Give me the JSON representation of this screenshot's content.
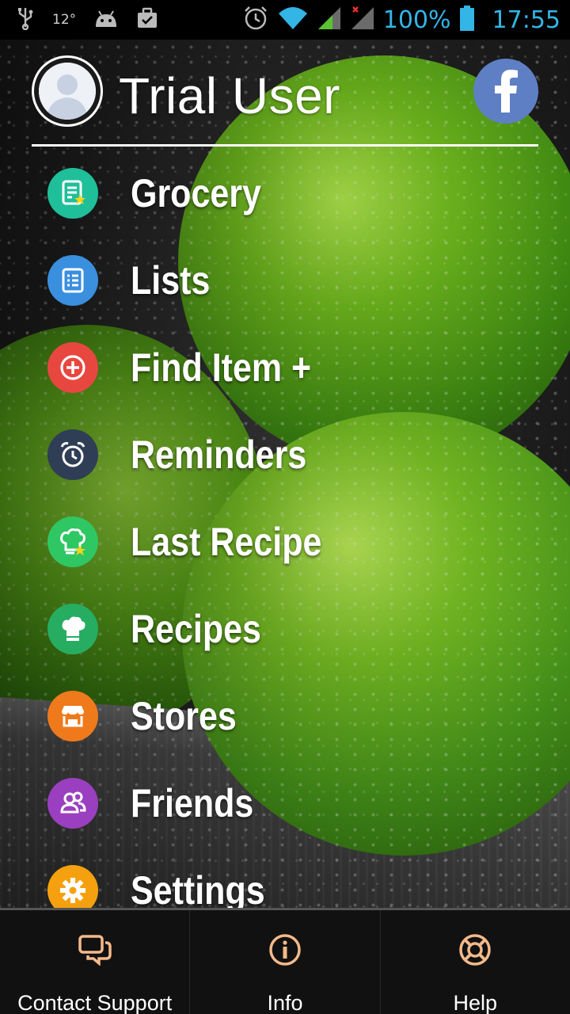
{
  "status_bar": {
    "temperature": "12°",
    "battery_percent": "100%",
    "clock": "17:55"
  },
  "drawer": {
    "user_name": "Trial User",
    "facebook_icon": "facebook-icon",
    "menu": [
      {
        "label": "Grocery",
        "icon": "grocery-list-star-icon",
        "color": "#1fbf9a"
      },
      {
        "label": "Lists",
        "icon": "list-icon",
        "color": "#3a8fde"
      },
      {
        "label": "Find Item +",
        "icon": "add-circle-icon",
        "color": "#e8473f"
      },
      {
        "label": "Reminders",
        "icon": "alarm-clock-icon",
        "color": "#2f3e55"
      },
      {
        "label": "Last Recipe",
        "icon": "chef-hat-star-icon",
        "color": "#2fc763"
      },
      {
        "label": "Recipes",
        "icon": "chef-hat-icon",
        "color": "#27ad62"
      },
      {
        "label": "Stores",
        "icon": "store-icon",
        "color": "#ef7a1c"
      },
      {
        "label": "Friends",
        "icon": "friends-icon",
        "color": "#9a3fbf"
      },
      {
        "label": "Settings",
        "icon": "gear-icon",
        "color": "#f5a10f"
      }
    ]
  },
  "bottom_bar": {
    "contact_support": "Contact Support",
    "info": "Info",
    "help": "Help",
    "icon_color": "#f4b98a"
  }
}
